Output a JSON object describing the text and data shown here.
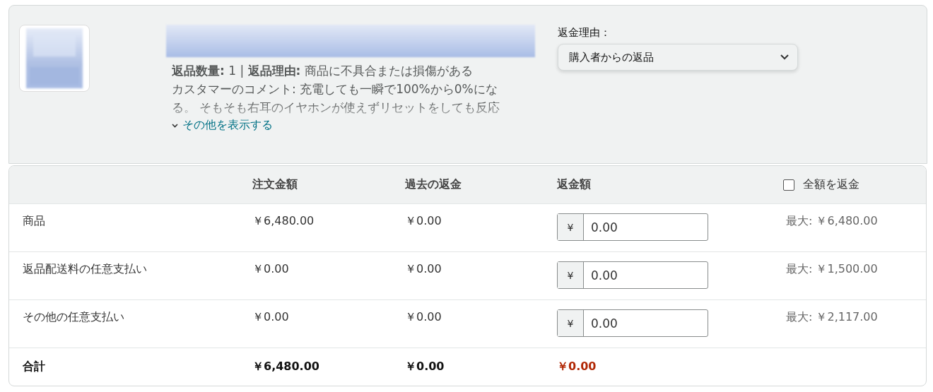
{
  "product": {
    "kind": "picture",
    "quantity_line": "**返品数量:** 1 | **返品理由:** 商品に不具合または損傷がある",
    "comment": "カスタマーのコメント: 充電しても一瞬で100%から0%になる。 そもそも右耳のイヤホンが使えずリセットをしても反応",
    "show_more": "その他を表示する"
  },
  "reason": {
    "label": "返金理由：",
    "value": "購入者からの返品"
  },
  "table": {
    "columns": [
      "注文金額",
      "過去の返金",
      "返金額"
    ],
    "full_refund": {
      "label": "全額を返金",
      "checked": false
    },
    "rows": [
      {
        "label": "商品",
        "order": "￥6,480.00",
        "past": "￥0.00",
        "currency": "¥",
        "value": "0.00",
        "max": "最大: ￥6,480.00"
      },
      {
        "label": "返品配送料の任意支払い",
        "order": "￥0.00",
        "past": "￥0.00",
        "currency": "¥",
        "value": "0.00",
        "max": "最大: ￥1,500.00"
      },
      {
        "label": "その他の任意支払い",
        "order": "￥0.00",
        "past": "￥0.00",
        "currency": "¥",
        "value": "0.00",
        "max": "最大: ￥2,117.00"
      }
    ],
    "total": {
      "label": "合計",
      "order": "￥6,480.00",
      "past": "￥0.00",
      "refund": "￥0.00"
    }
  }
}
